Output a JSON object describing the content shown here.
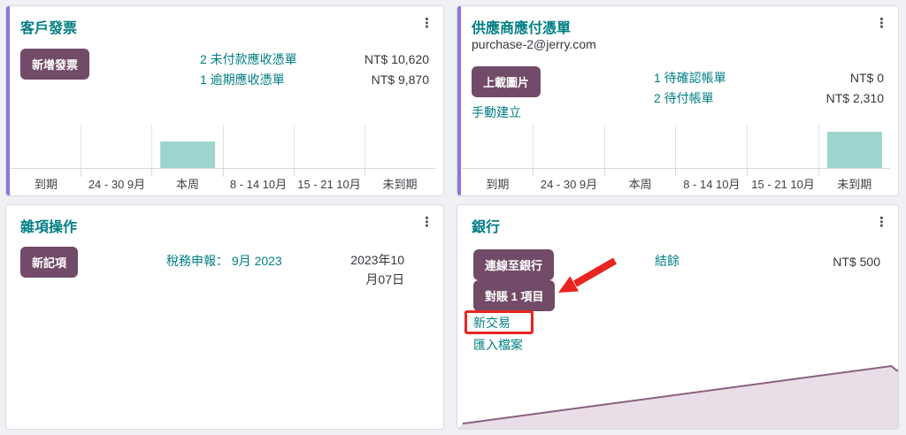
{
  "colors": {
    "accent_purple": "#8d74da",
    "teal_link": "#017e84",
    "button_bg": "#714b67",
    "bar_fill": "#9dd5ce",
    "area_fill": "#e9dee7",
    "area_line": "#8c5f7f",
    "annotation_red": "#e8251f"
  },
  "icons": {
    "kebab_menu": "⋮"
  },
  "cards": {
    "customer_invoices": {
      "title": "客戶發票",
      "new_invoice_button": "新增發票",
      "rows": [
        {
          "link": "2 未付款應收憑單",
          "amount": "NT$ 10,620"
        },
        {
          "link": "1 逾期應收憑單",
          "amount": "NT$ 9,870"
        }
      ]
    },
    "vendor_bills": {
      "title": "供應商應付憑單",
      "subtitle": "purchase-2@jerry.com",
      "upload_button": "上載圖片",
      "manual_link": "手動建立",
      "rows": [
        {
          "link": "1 待確認帳單",
          "amount": "NT$ 0"
        },
        {
          "link": "2 待付帳單",
          "amount": "NT$ 2,310"
        }
      ]
    },
    "misc_operations": {
      "title": "雜項操作",
      "new_entry_button": "新記項",
      "tax_report_link": "稅務申報： 9月 2023",
      "date": "2023年10\n月07日"
    },
    "bank": {
      "title": "銀行",
      "connect_button": "連線至銀行",
      "reconcile_button": "對賬 1 項目",
      "new_transaction_link": "新交易",
      "import_link": "匯入檔案",
      "balance_label": "結餘",
      "balance_amount": "NT$ 500"
    }
  },
  "chart_data": [
    {
      "type": "bar",
      "card": "客戶發票",
      "categories": [
        "到期",
        "24 - 30 9月",
        "本周",
        "8 - 14 10月",
        "15 - 21 10月",
        "未到期"
      ],
      "heights_frac": [
        0,
        0,
        0.6,
        0,
        0,
        0
      ],
      "note": "single teal bar at 本周; y values not labelled in UI",
      "bar_color": "#9dd5ce"
    },
    {
      "type": "bar",
      "card": "供應商應付憑單",
      "categories": [
        "到期",
        "24 - 30 9月",
        "本周",
        "8 - 14 10月",
        "15 - 21 10月",
        "未到期"
      ],
      "heights_frac": [
        0,
        0,
        0,
        0,
        0,
        0.82
      ],
      "note": "single teal bar at 未到期; y values not labelled in UI",
      "bar_color": "#9dd5ce"
    },
    {
      "type": "area",
      "card": "銀行",
      "points_frac": [
        [
          0.012,
          0.08
        ],
        [
          0.985,
          0.96
        ],
        [
          0.997,
          0.89
        ],
        [
          1,
          0.9
        ]
      ],
      "note": "balance trend rising linearly left-to-right with tiny dip at far right",
      "fill": "#e9dee7",
      "stroke": "#8c5f7f"
    }
  ]
}
